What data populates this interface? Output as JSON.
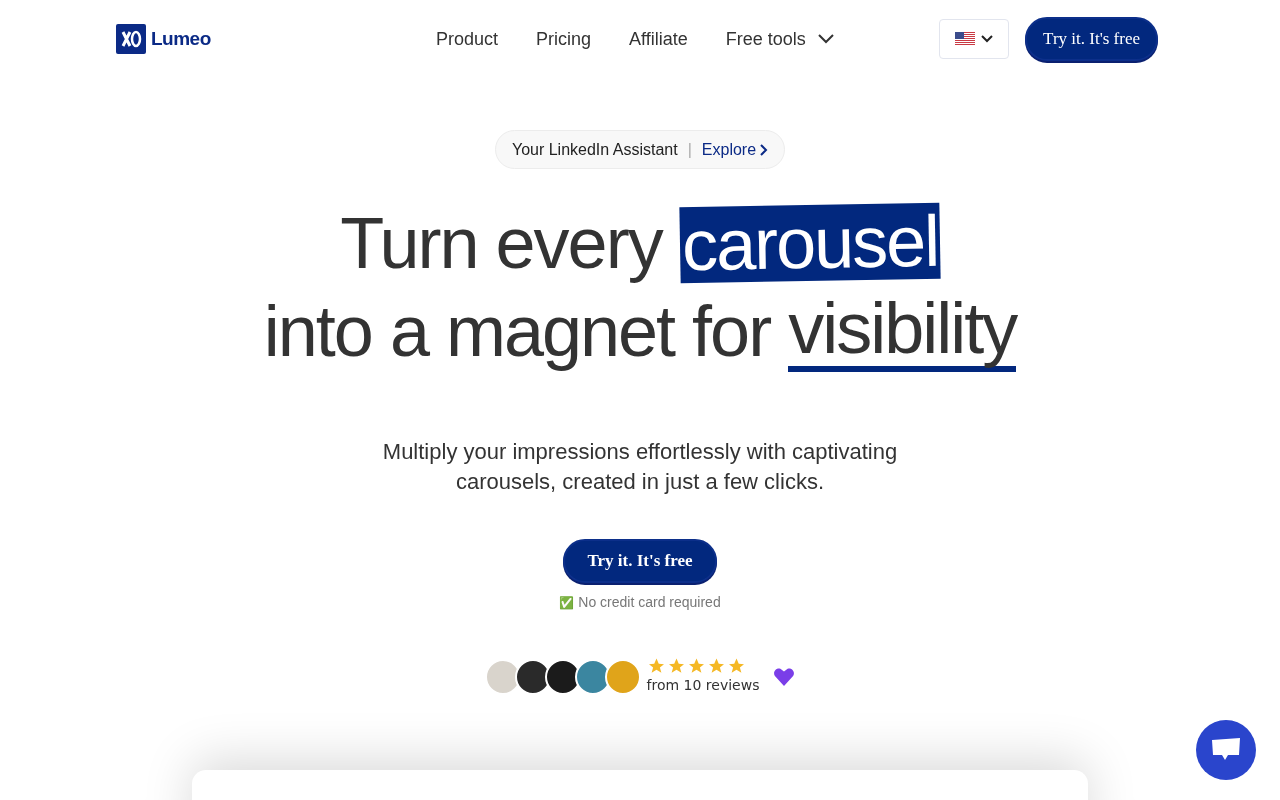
{
  "nav": {
    "logo": "Lumeo",
    "links": [
      {
        "label": "Product",
        "kind": "link"
      },
      {
        "label": "Pricing",
        "kind": "link"
      },
      {
        "label": "Affiliate",
        "kind": "link"
      },
      {
        "label": "Free tools",
        "kind": "dropdown"
      }
    ],
    "cta": "Try it. It's free"
  },
  "badge": {
    "text": "Your LinkedIn Assistant",
    "separator": "|",
    "link": "Explore"
  },
  "headline": {
    "line1": "Turn every ",
    "highlight": "carousel",
    "line2": "into a magnet for ",
    "underlined": "visibility"
  },
  "subtitle": "Multiply your impressions effortlessly with captivating carousels, created in just a few clicks.",
  "cta": "Try it. It's free",
  "note": {
    "icon": "✅",
    "text": "No credit card required"
  },
  "reviews": {
    "avatars": [
      {
        "color": "#d9d4cc"
      },
      {
        "color": "#2a2a2a"
      },
      {
        "color": "#1b1b1b"
      },
      {
        "color": "#3b86a0"
      },
      {
        "color": "#e0a41a"
      }
    ],
    "stars": 5,
    "text": "from 10 reviews"
  }
}
